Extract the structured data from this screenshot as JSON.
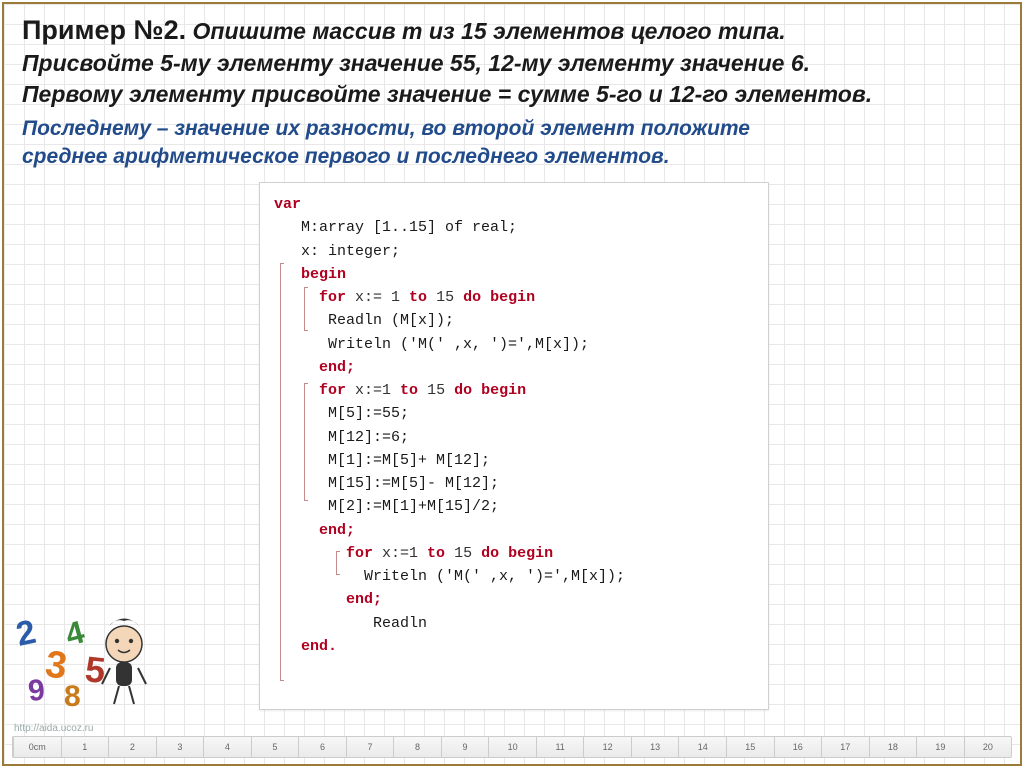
{
  "header": {
    "titleStrong": "Пример №2.",
    "titleRest": "Опишите массив m из 15 элементов целого типа.",
    "line2": "Присвойте 5-му элементу значение 55, 12-му элементу значение 6.",
    "line3": "Первому элементу присвойте значение = сумме 5-го и 12-го элементов.",
    "line4": "Последнему – значение их разности, во второй элемент положите",
    "line5": "среднее арифметическое первого и последнего элементов."
  },
  "code": {
    "l1": "var",
    "l2": "   M:array [1..15] of real;",
    "l3": "   x: integer;",
    "l4": "   begin",
    "l5": "     for x:= 1 to 15 do begin",
    "l6": "      Readln (M[x]);",
    "l7": "      Writeln ('M(' ,x, ')=',M[x]);",
    "l8": "     end;",
    "l9": "     for x:=1 to 15 do begin",
    "l10": "      M[5]:=55;",
    "l11": "      M[12]:=6;",
    "l12": "      M[1]:=M[5]+ M[12];",
    "l13": "      M[15]:=M[5]- M[12];",
    "l14": "      M[2]:=M[1]+M[15]/2;",
    "l15": "     end;",
    "l16": "        for x:=1 to 15 do begin",
    "l17": "          Writeln ('M(' ,x, ')=',M[x]);",
    "l18": "",
    "l19": "        end;",
    "l20": "           Readln",
    "l21": "   end."
  },
  "ruler": [
    "0cm",
    "1",
    "2",
    "3",
    "4",
    "5",
    "6",
    "7",
    "8",
    "9",
    "10",
    "11",
    "12",
    "13",
    "14",
    "15",
    "16",
    "17",
    "18",
    "19",
    "20"
  ],
  "watermark": "http://aida.ucoz.ru"
}
